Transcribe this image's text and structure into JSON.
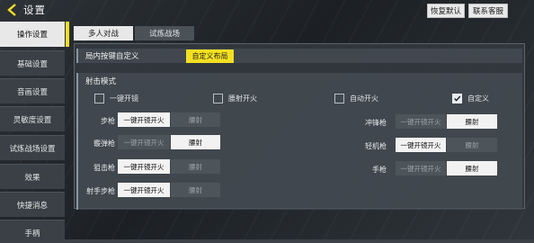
{
  "header": {
    "title": "设置",
    "buttons": [
      "恢复默认",
      "联系客服"
    ]
  },
  "sidebar": {
    "items": [
      {
        "label": "操作设置",
        "active": true
      },
      {
        "label": "基础设置"
      },
      {
        "label": "音画设置"
      },
      {
        "label": "灵敏度设置"
      },
      {
        "label": "试炼战场设置"
      },
      {
        "label": "效果"
      },
      {
        "label": "快捷消息"
      },
      {
        "label": "手柄"
      }
    ]
  },
  "tabs": [
    {
      "label": "多人对战",
      "active": true
    },
    {
      "label": "试炼战场"
    }
  ],
  "custom_layout": {
    "label": "局内按键自定义",
    "button": "自定义布局"
  },
  "fire_mode": {
    "label": "射击模式",
    "options": [
      {
        "label": "一键开镜",
        "checked": false
      },
      {
        "label": "腰射开火",
        "checked": false
      },
      {
        "label": "自动开火",
        "checked": false
      },
      {
        "label": "自定义",
        "checked": true
      }
    ],
    "weapons_left": [
      {
        "name": "步枪",
        "opt1": "一键开镜开火",
        "opt2": "腰射",
        "selected": "opt1"
      },
      {
        "name": "霰弹枪",
        "opt1": "一键开镜开火",
        "opt2": "腰射",
        "selected": "opt2"
      },
      {
        "name": "狙击枪",
        "opt1": "一键开镜开火",
        "opt2": "腰射",
        "selected": "opt1"
      },
      {
        "name": "射手步枪",
        "opt1": "一键开镜开火",
        "opt2": "腰射",
        "selected": "opt1"
      }
    ],
    "weapons_right": [
      {
        "name": "冲锋枪",
        "opt1": "一键开镜开火",
        "opt2": "腰射",
        "selected": "opt2"
      },
      {
        "name": "轻机枪",
        "opt1": "一键开镜开火",
        "opt2": "腰射",
        "selected": "opt1"
      },
      {
        "name": "手枪",
        "opt1": "一键开镜开火",
        "opt2": "腰射",
        "selected": "opt2"
      }
    ]
  },
  "colors": {
    "accent": "#f4e021",
    "selected": "#f2f2f2",
    "unselected": "#4d545a"
  }
}
